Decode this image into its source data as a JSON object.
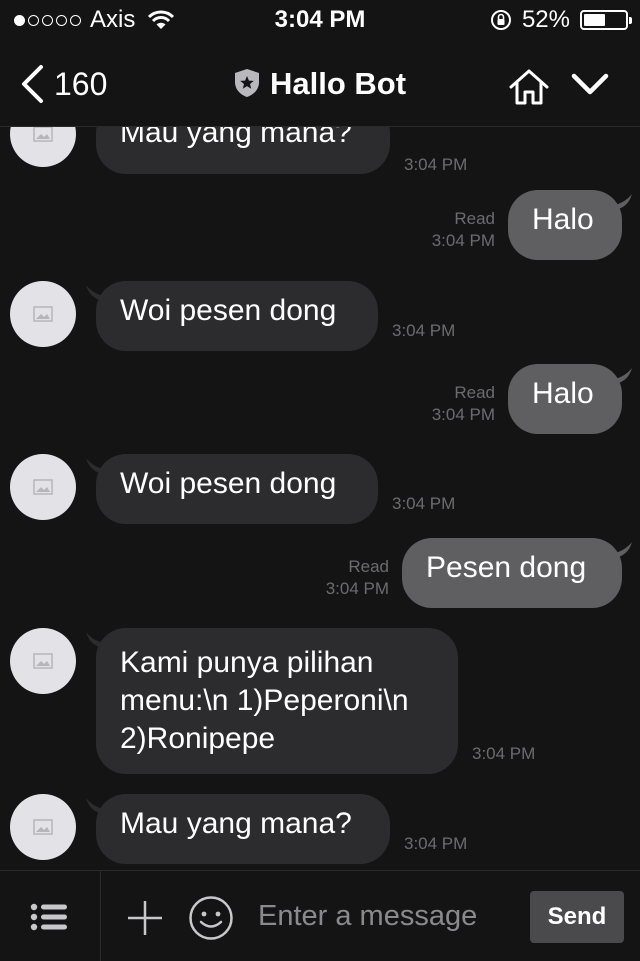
{
  "status_bar": {
    "carrier": "Axis",
    "time": "3:04 PM",
    "battery": "52%",
    "battery_level": 0.52,
    "signal_bars": 1
  },
  "header": {
    "back_count": "160",
    "title": "Hallo Bot"
  },
  "messages": [
    {
      "side": "in",
      "text": "Mau yang mana?",
      "time": "3:04 PM"
    },
    {
      "side": "out",
      "text": "Halo",
      "read": "Read",
      "time": "3:04 PM"
    },
    {
      "side": "in",
      "text": "Woi pesen dong",
      "time": "3:04 PM"
    },
    {
      "side": "out",
      "text": "Halo",
      "read": "Read",
      "time": "3:04 PM"
    },
    {
      "side": "in",
      "text": "Woi pesen dong",
      "time": "3:04 PM"
    },
    {
      "side": "out",
      "text": "Pesen dong",
      "read": "Read",
      "time": "3:04 PM"
    },
    {
      "side": "in",
      "text": "Kami punya pilihan\nmenu:\\n 1)Peperoni\\n\n2)Ronipepe",
      "time": "3:04 PM"
    },
    {
      "side": "in",
      "text": "Mau yang mana?",
      "time": "3:04 PM"
    }
  ],
  "composer": {
    "placeholder": "Enter a message",
    "send_label": "Send"
  }
}
